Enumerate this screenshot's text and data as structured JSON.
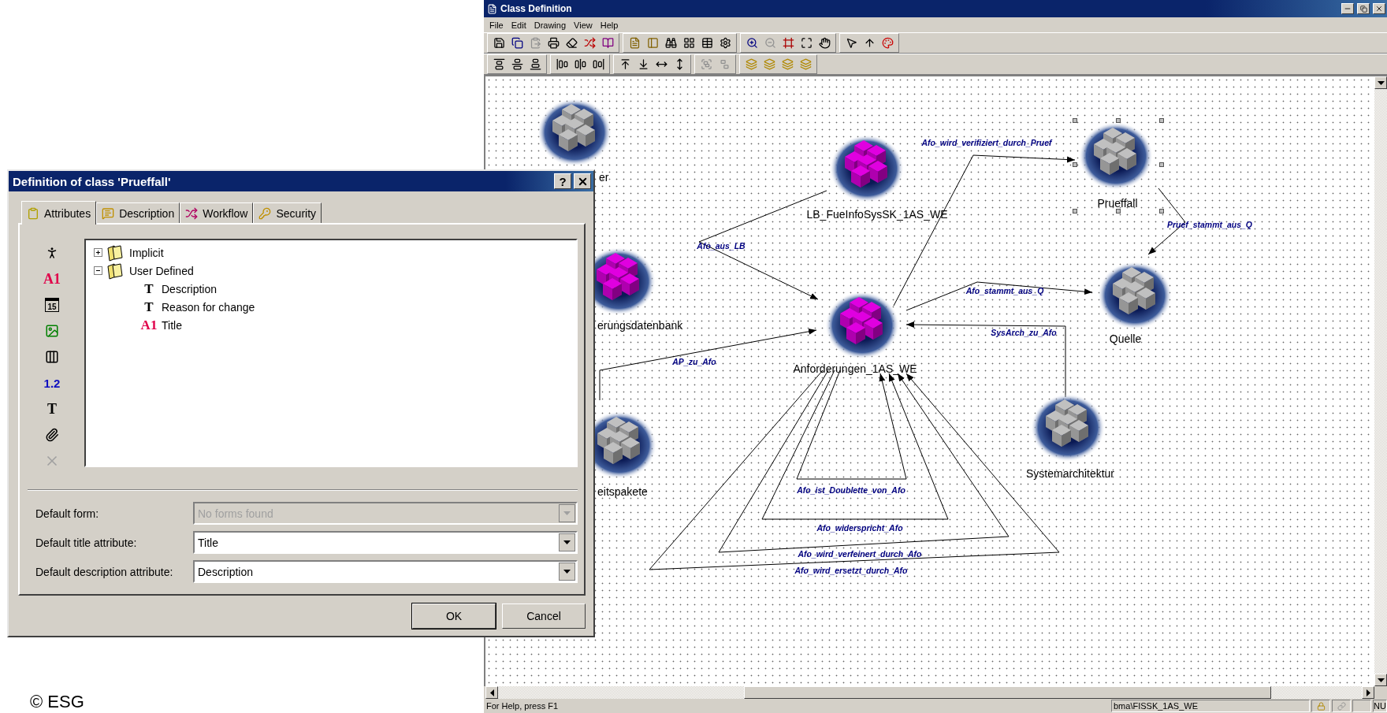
{
  "app": {
    "title": "Class Definition",
    "menu": [
      "File",
      "Edit",
      "Drawing",
      "View",
      "Help"
    ],
    "nodes": [
      {
        "label": "er",
        "color": "#c0c0c0",
        "selected": false
      },
      {
        "label": "LB_FueInfoSysSK_1AS_WE",
        "color": "#e000e0",
        "selected": false
      },
      {
        "label": "Prueffall",
        "color": "#c0c0c0",
        "selected": true
      },
      {
        "label": "erungsdatenbank",
        "color": "#e000e0",
        "selected": false
      },
      {
        "label": "Anforderungen_1AS_WE",
        "color": "#e000e0",
        "selected": false
      },
      {
        "label": "Quelle",
        "color": "#c0c0c0",
        "selected": false
      },
      {
        "label": "eitspakete",
        "color": "#c0c0c0",
        "selected": false
      },
      {
        "label": "Systemarchitektur",
        "color": "#c0c0c0",
        "selected": false
      }
    ],
    "edges": [
      {
        "label": "Afo_wird_verifiziert_durch_Pruef"
      },
      {
        "label": "Afo_aus_LB"
      },
      {
        "label": "Pruef_stammt_aus_Q"
      },
      {
        "label": "Afo_stammt_aus_Q"
      },
      {
        "label": "SysArch_zu_Afo"
      },
      {
        "label": "AP_zu_Afo"
      },
      {
        "label": "Afo_ist_Doublette_von_Afo"
      },
      {
        "label": "Afo_widerspricht_Afo"
      },
      {
        "label": "Afo_wird_verfeinert_durch_Afo"
      },
      {
        "label": "Afo_wird_ersetzt_durch_Afo"
      }
    ],
    "status_bar": {
      "message": "For Help, press F1",
      "path": "bma\\FISSK_1AS_WE",
      "indicator": "NU"
    }
  },
  "dialog": {
    "title": "Definition of class 'Prueffall'",
    "help_button": "?",
    "tabs": [
      {
        "label": "Attributes",
        "selected": true
      },
      {
        "label": "Description",
        "selected": false
      },
      {
        "label": "Workflow",
        "selected": false
      },
      {
        "label": "Security",
        "selected": false
      }
    ],
    "palette": [
      {
        "kind": "person",
        "disabled": false
      },
      {
        "kind": "title",
        "glyph": "A1",
        "disabled": false
      },
      {
        "kind": "date",
        "glyph": "15",
        "disabled": false
      },
      {
        "kind": "image",
        "disabled": false
      },
      {
        "kind": "column",
        "disabled": false
      },
      {
        "kind": "number",
        "glyph": "1.2",
        "disabled": false
      },
      {
        "kind": "text",
        "glyph": "T",
        "disabled": false
      },
      {
        "kind": "attachment",
        "disabled": false
      },
      {
        "kind": "delete",
        "disabled": true
      }
    ],
    "tree": [
      {
        "label": "Implicit",
        "expanded": false
      },
      {
        "label": "User Defined",
        "expanded": true,
        "children": [
          {
            "label": "Description",
            "kind": "text",
            "glyph": "T"
          },
          {
            "label": "Reason for change",
            "kind": "text",
            "glyph": "T"
          },
          {
            "label": "Title",
            "kind": "title",
            "glyph": "A1"
          }
        ]
      }
    ],
    "fields": [
      {
        "label": "Default form:",
        "value": "No forms found",
        "disabled": true
      },
      {
        "label": "Default title attribute:",
        "value": "Title",
        "disabled": false
      },
      {
        "label": "Default description attribute:",
        "value": "Description",
        "disabled": false
      }
    ],
    "buttons": [
      {
        "label": "OK",
        "default": true
      },
      {
        "label": "Cancel",
        "default": false
      }
    ]
  },
  "copyright": "© ESG"
}
